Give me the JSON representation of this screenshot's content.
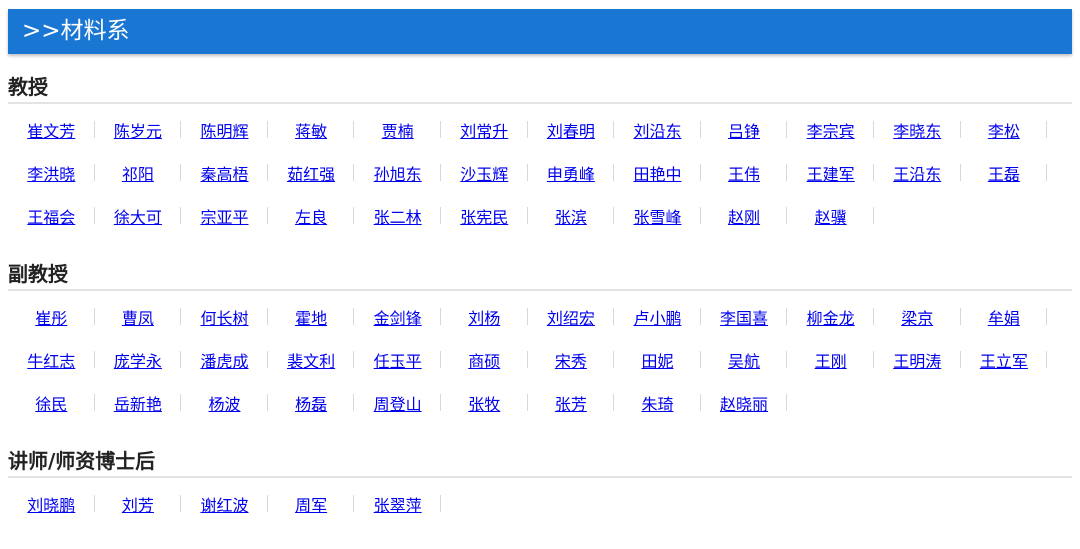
{
  "header": {
    "title": ">>材料系"
  },
  "sections": [
    {
      "title": "教授",
      "names": [
        "崔文芳",
        "陈岁元",
        "陈明辉",
        "蒋敏",
        "贾楠",
        "刘常升",
        "刘春明",
        "刘沿东",
        "吕铮",
        "李宗宾",
        "李晓东",
        "李松",
        "李洪晓",
        "祁阳",
        "秦高梧",
        "茹红强",
        "孙旭东",
        "沙玉辉",
        "申勇峰",
        "田艳中",
        "王伟",
        "王建军",
        "王沿东",
        "王磊",
        "王福会",
        "徐大可",
        "宗亚平",
        "左良",
        "张二林",
        "张宪民",
        "张滨",
        "张雪峰",
        "赵刚",
        "赵骥"
      ]
    },
    {
      "title": "副教授",
      "names": [
        "崔彤",
        "曹凤",
        "何长树",
        "霍地",
        "金剑锋",
        "刘杨",
        "刘绍宏",
        "卢小鹏",
        "李国喜",
        "柳金龙",
        "梁京",
        "牟娟",
        "牛红志",
        "庞学永",
        "潘虎成",
        "裴文利",
        "任玉平",
        "商硕",
        "宋秀",
        "田妮",
        "吴航",
        "王刚",
        "王明涛",
        "王立军",
        "徐民",
        "岳新艳",
        "杨波",
        "杨磊",
        "周登山",
        "张牧",
        "张芳",
        "朱琦",
        "赵晓丽"
      ]
    },
    {
      "title": "讲师/师资博士后",
      "names": [
        "刘晓鹏",
        "刘芳",
        "谢红波",
        "周军",
        "张翠萍"
      ]
    }
  ]
}
